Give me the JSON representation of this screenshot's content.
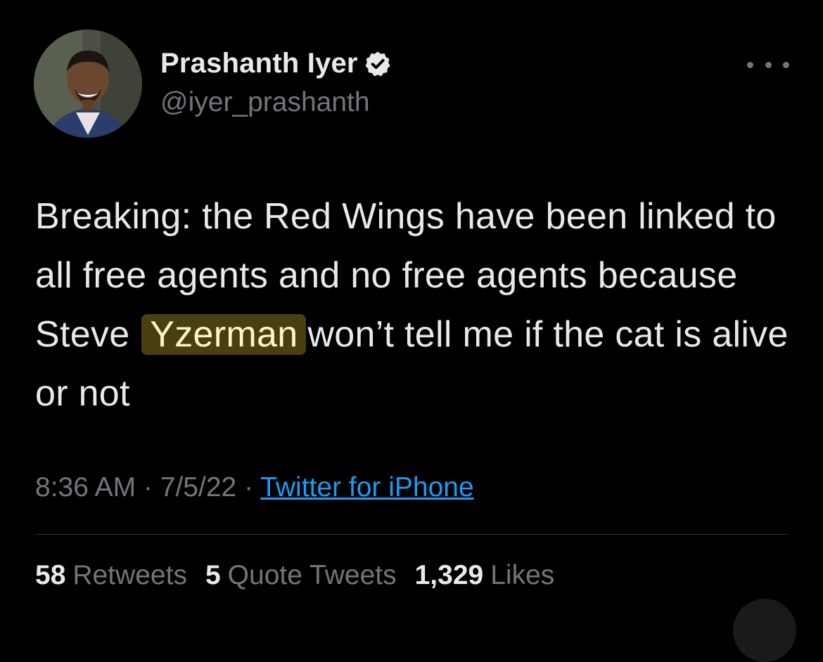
{
  "author": {
    "name": "Prashanth Iyer",
    "handle": "@iyer_prashanth",
    "verified_icon": "verified-badge-icon",
    "avatar_icon": "profile-photo"
  },
  "tweet": {
    "text_before": "Breaking: the Red Wings have been linked to all free agents and no free agents because Steve",
    "text_highlight": "Yzerman",
    "text_after": "won’t tell me if the cat is alive or not",
    "highlight_color": "#4a3f10"
  },
  "meta": {
    "time": "8:36 AM",
    "separator": "·",
    "date": "7/5/22",
    "source": "Twitter for iPhone"
  },
  "stats": {
    "retweets_count": "58",
    "retweets_label": "Retweets",
    "quotes_count": "5",
    "quotes_label": "Quote Tweets",
    "likes_count": "1,329",
    "likes_label": "Likes"
  },
  "colors": {
    "background": "#000000",
    "primary_text": "#e7e9ea",
    "secondary_text": "#71767b",
    "link": "#1d9bf0"
  }
}
